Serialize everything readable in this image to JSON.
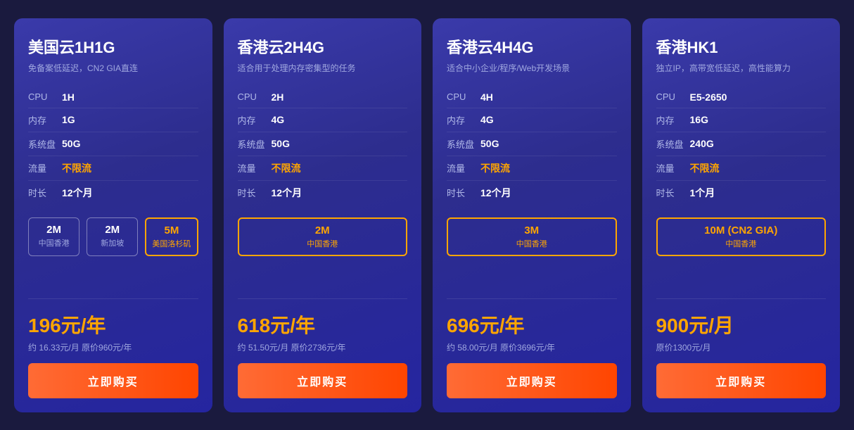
{
  "cards": [
    {
      "id": "card-1",
      "title": "美国云1H1G",
      "subtitle": "免备案低延迟，CN2 GIA直连",
      "specs": [
        {
          "label": "CPU",
          "value": "1H",
          "unlimited": false
        },
        {
          "label": "内存",
          "value": "1G",
          "unlimited": false
        },
        {
          "label": "系统盘",
          "value": "50G",
          "unlimited": false
        },
        {
          "label": "流量",
          "value": "不限流",
          "unlimited": true
        },
        {
          "label": "时长",
          "value": "12个月",
          "unlimited": false
        }
      ],
      "bandwidths": [
        {
          "speed": "2M",
          "location": "中国香港",
          "active": false
        },
        {
          "speed": "2M",
          "location": "新加坡",
          "active": false
        },
        {
          "speed": "5M",
          "location": "美国洛杉矶",
          "active": true
        }
      ],
      "price_main": "196元/年",
      "price_sub": "约 16.33元/月 原价960元/年",
      "buy_label": "立即购买"
    },
    {
      "id": "card-2",
      "title": "香港云2H4G",
      "subtitle": "适合用于处理内存密集型的任务",
      "specs": [
        {
          "label": "CPU",
          "value": "2H",
          "unlimited": false
        },
        {
          "label": "内存",
          "value": "4G",
          "unlimited": false
        },
        {
          "label": "系统盘",
          "value": "50G",
          "unlimited": false
        },
        {
          "label": "流量",
          "value": "不限流",
          "unlimited": true
        },
        {
          "label": "时长",
          "value": "12个月",
          "unlimited": false
        }
      ],
      "bandwidths": [
        {
          "speed": "2M",
          "location": "中国香港",
          "active": true
        }
      ],
      "price_main": "618元/年",
      "price_sub": "约 51.50元/月 原价2736元/年",
      "buy_label": "立即购买"
    },
    {
      "id": "card-3",
      "title": "香港云4H4G",
      "subtitle": "适合中小企业/程序/Web开发场景",
      "specs": [
        {
          "label": "CPU",
          "value": "4H",
          "unlimited": false
        },
        {
          "label": "内存",
          "value": "4G",
          "unlimited": false
        },
        {
          "label": "系统盘",
          "value": "50G",
          "unlimited": false
        },
        {
          "label": "流量",
          "value": "不限流",
          "unlimited": true
        },
        {
          "label": "时长",
          "value": "12个月",
          "unlimited": false
        }
      ],
      "bandwidths": [
        {
          "speed": "3M",
          "location": "中国香港",
          "active": true
        }
      ],
      "price_main": "696元/年",
      "price_sub": "约 58.00元/月 原价3696元/年",
      "buy_label": "立即购买"
    },
    {
      "id": "card-4",
      "title": "香港HK1",
      "subtitle": "独立IP，高带宽低延迟，高性能算力",
      "specs": [
        {
          "label": "CPU",
          "value": "E5-2650",
          "unlimited": false
        },
        {
          "label": "内存",
          "value": "16G",
          "unlimited": false
        },
        {
          "label": "系统盘",
          "value": "240G",
          "unlimited": false
        },
        {
          "label": "流量",
          "value": "不限流",
          "unlimited": true
        },
        {
          "label": "时长",
          "value": "1个月",
          "unlimited": false
        }
      ],
      "bandwidths": [
        {
          "speed": "10M (CN2 GIA)",
          "location": "中国香港",
          "active": true
        }
      ],
      "price_main": "900元/月",
      "price_sub": "原价1300元/月",
      "buy_label": "立即购买"
    }
  ]
}
